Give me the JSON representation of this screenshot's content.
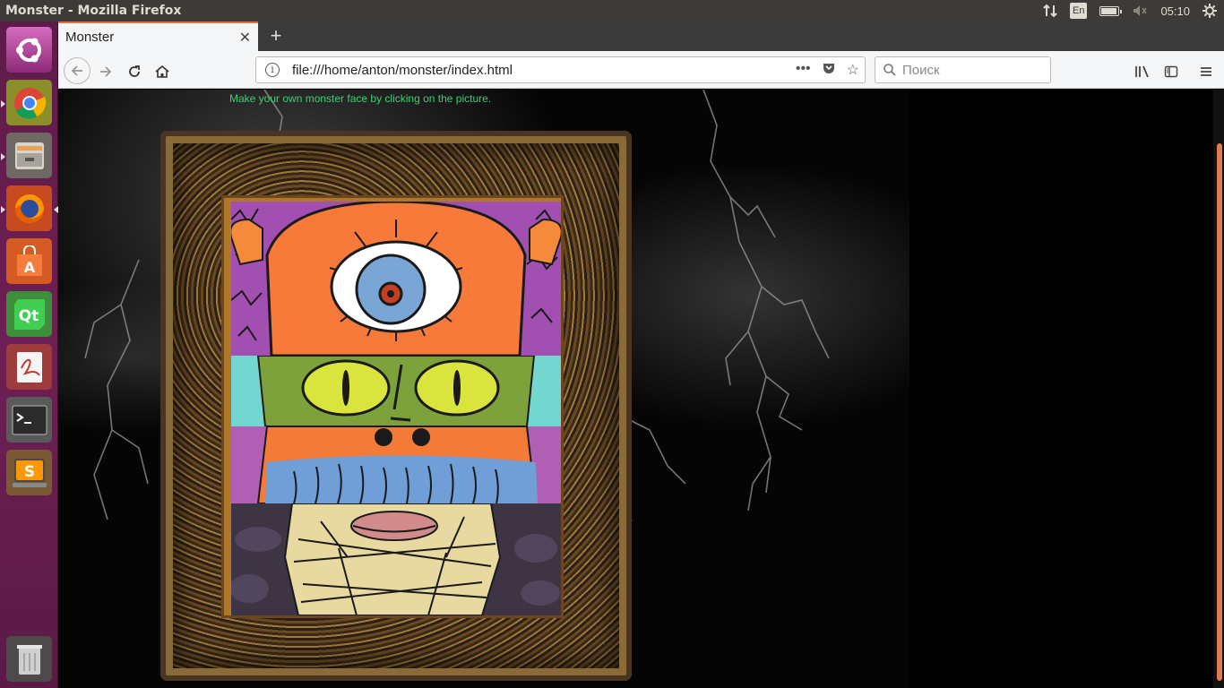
{
  "system": {
    "window_title": "Monster - Mozilla Firefox",
    "keyboard_layout": "En",
    "clock": "05:10"
  },
  "browser": {
    "tab_title": "Monster",
    "url": "file:///home/anton/monster/index.html",
    "search_placeholder": "Поиск"
  },
  "page": {
    "instructions": "Make your own monster face by clicking on the picture."
  },
  "launcher": {
    "items": [
      "ubuntu-dash",
      "chrome",
      "files",
      "firefox",
      "software-center",
      "qt-creator",
      "document-viewer",
      "terminal",
      "sublime-text",
      "trash"
    ]
  },
  "colors": {
    "instruction_green": "#3bd16f",
    "tab_accent": "#e66f3a",
    "launcher_bg": "#6d1f54"
  }
}
